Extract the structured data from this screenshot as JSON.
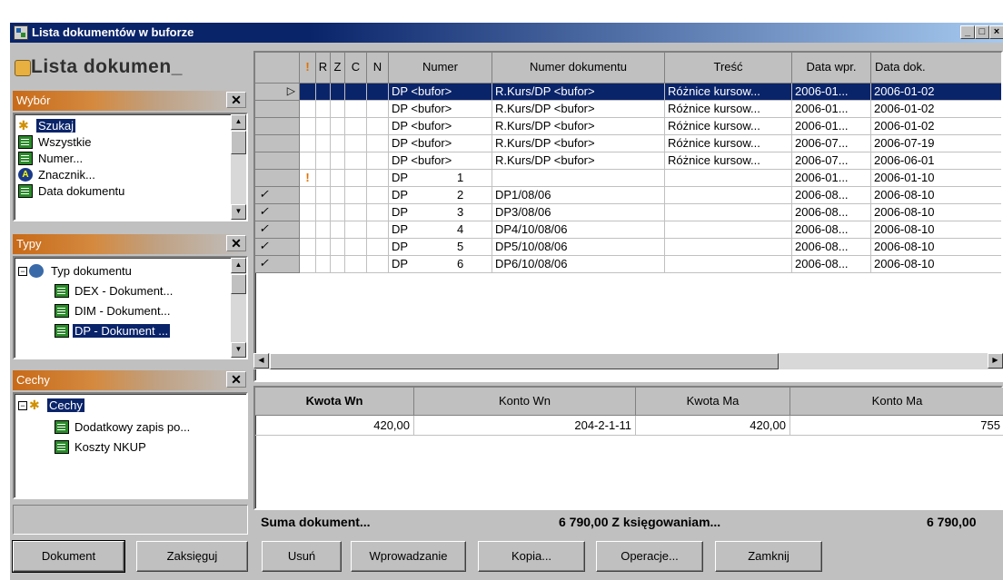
{
  "window": {
    "title": "Lista dokumentów w buforze",
    "controls": [
      "_",
      "□",
      "×"
    ]
  },
  "left": {
    "heading": "Lista dokumen_",
    "wybor": {
      "title": "Wybór",
      "items": [
        {
          "label": "Szukaj",
          "icon": "search-star-icon",
          "selected": true
        },
        {
          "label": "Wszystkie",
          "icon": "list-icon"
        },
        {
          "label": "Numer...",
          "icon": "list-icon"
        },
        {
          "label": "Znacznik...",
          "icon": "tag-a-icon"
        },
        {
          "label": "Data dokumentu",
          "icon": "list-icon"
        }
      ]
    },
    "typy": {
      "title": "Typy",
      "root": "Typ dokumentu",
      "items": [
        "DEX - Dokument...",
        "DIM - Dokument...",
        "DP - Dokument ..."
      ]
    },
    "cechy": {
      "title": "Cechy",
      "root": "Cechy",
      "items": [
        "Dodatkowy zapis po...",
        "Koszty NKUP"
      ]
    }
  },
  "grid": {
    "columns": [
      "!",
      "R",
      "Z",
      "C",
      "N",
      "Numer",
      "Numer dokumentu",
      "Treść",
      "Data wpr.",
      "Data dok."
    ],
    "rows": [
      {
        "mark": "",
        "flag": "",
        "numer": "DP <bufor>",
        "nr": "",
        "numer_dok": "R.Kurs/DP <bufor>",
        "tresc": "Różnice kursow...",
        "data_wpr": "2006-01...",
        "data_dok": "2006-01-02",
        "selected": true,
        "current": true
      },
      {
        "mark": "",
        "flag": "",
        "numer": "DP <bufor>",
        "nr": "",
        "numer_dok": "R.Kurs/DP <bufor>",
        "tresc": "Różnice kursow...",
        "data_wpr": "2006-01...",
        "data_dok": "2006-01-02"
      },
      {
        "mark": "",
        "flag": "",
        "numer": "DP <bufor>",
        "nr": "",
        "numer_dok": "R.Kurs/DP <bufor>",
        "tresc": "Różnice kursow...",
        "data_wpr": "2006-01...",
        "data_dok": "2006-01-02"
      },
      {
        "mark": "",
        "flag": "",
        "numer": "DP <bufor>",
        "nr": "",
        "numer_dok": "R.Kurs/DP <bufor>",
        "tresc": "Różnice kursow...",
        "data_wpr": "2006-07...",
        "data_dok": "2006-07-19"
      },
      {
        "mark": "",
        "flag": "",
        "numer": "DP <bufor>",
        "nr": "",
        "numer_dok": "R.Kurs/DP <bufor>",
        "tresc": "Różnice kursow...",
        "data_wpr": "2006-07...",
        "data_dok": "2006-06-01"
      },
      {
        "mark": "",
        "flag": "!",
        "numer": "DP",
        "nr": "1",
        "numer_dok": "",
        "tresc": "",
        "data_wpr": "2006-01...",
        "data_dok": "2006-01-10"
      },
      {
        "mark": "✓",
        "flag": "",
        "numer": "DP",
        "nr": "2",
        "numer_dok": "DP1/08/06",
        "tresc": "",
        "data_wpr": "2006-08...",
        "data_dok": "2006-08-10"
      },
      {
        "mark": "✓",
        "flag": "",
        "numer": "DP",
        "nr": "3",
        "numer_dok": "DP3/08/06",
        "tresc": "",
        "data_wpr": "2006-08...",
        "data_dok": "2006-08-10"
      },
      {
        "mark": "✓",
        "flag": "",
        "numer": "DP",
        "nr": "4",
        "numer_dok": "DP4/10/08/06",
        "tresc": "",
        "data_wpr": "2006-08...",
        "data_dok": "2006-08-10"
      },
      {
        "mark": "✓",
        "flag": "",
        "numer": "DP",
        "nr": "5",
        "numer_dok": "DP5/10/08/06",
        "tresc": "",
        "data_wpr": "2006-08...",
        "data_dok": "2006-08-10"
      },
      {
        "mark": "✓",
        "flag": "",
        "numer": "DP",
        "nr": "6",
        "numer_dok": "DP6/10/08/06",
        "tresc": "",
        "data_wpr": "2006-08...",
        "data_dok": "2006-08-10"
      }
    ]
  },
  "entries": {
    "columns": [
      "Kwota Wn",
      "Konto Wn",
      "Kwota Ma",
      "Konto Ma"
    ],
    "rows": [
      [
        "420,00",
        "204-2-1-11",
        "420,00",
        "755"
      ]
    ]
  },
  "summary": {
    "label": "Suma dokument...",
    "value1": "6 790,00 Z księgowaniam...",
    "value2": "6 790,00"
  },
  "buttons": {
    "dokument": "Dokument",
    "zaksieguj": "Zaksięguj",
    "usun": "Usuń",
    "wprowadzanie": "Wprowadzanie",
    "kopia": "Kopia...",
    "operacje": "Operacje...",
    "zamknij": "Zamknij"
  },
  "colors": {
    "selection": "#0a246a",
    "panel_header": "#c86a18",
    "face": "#c0c0c0",
    "flag": "#e07000"
  }
}
